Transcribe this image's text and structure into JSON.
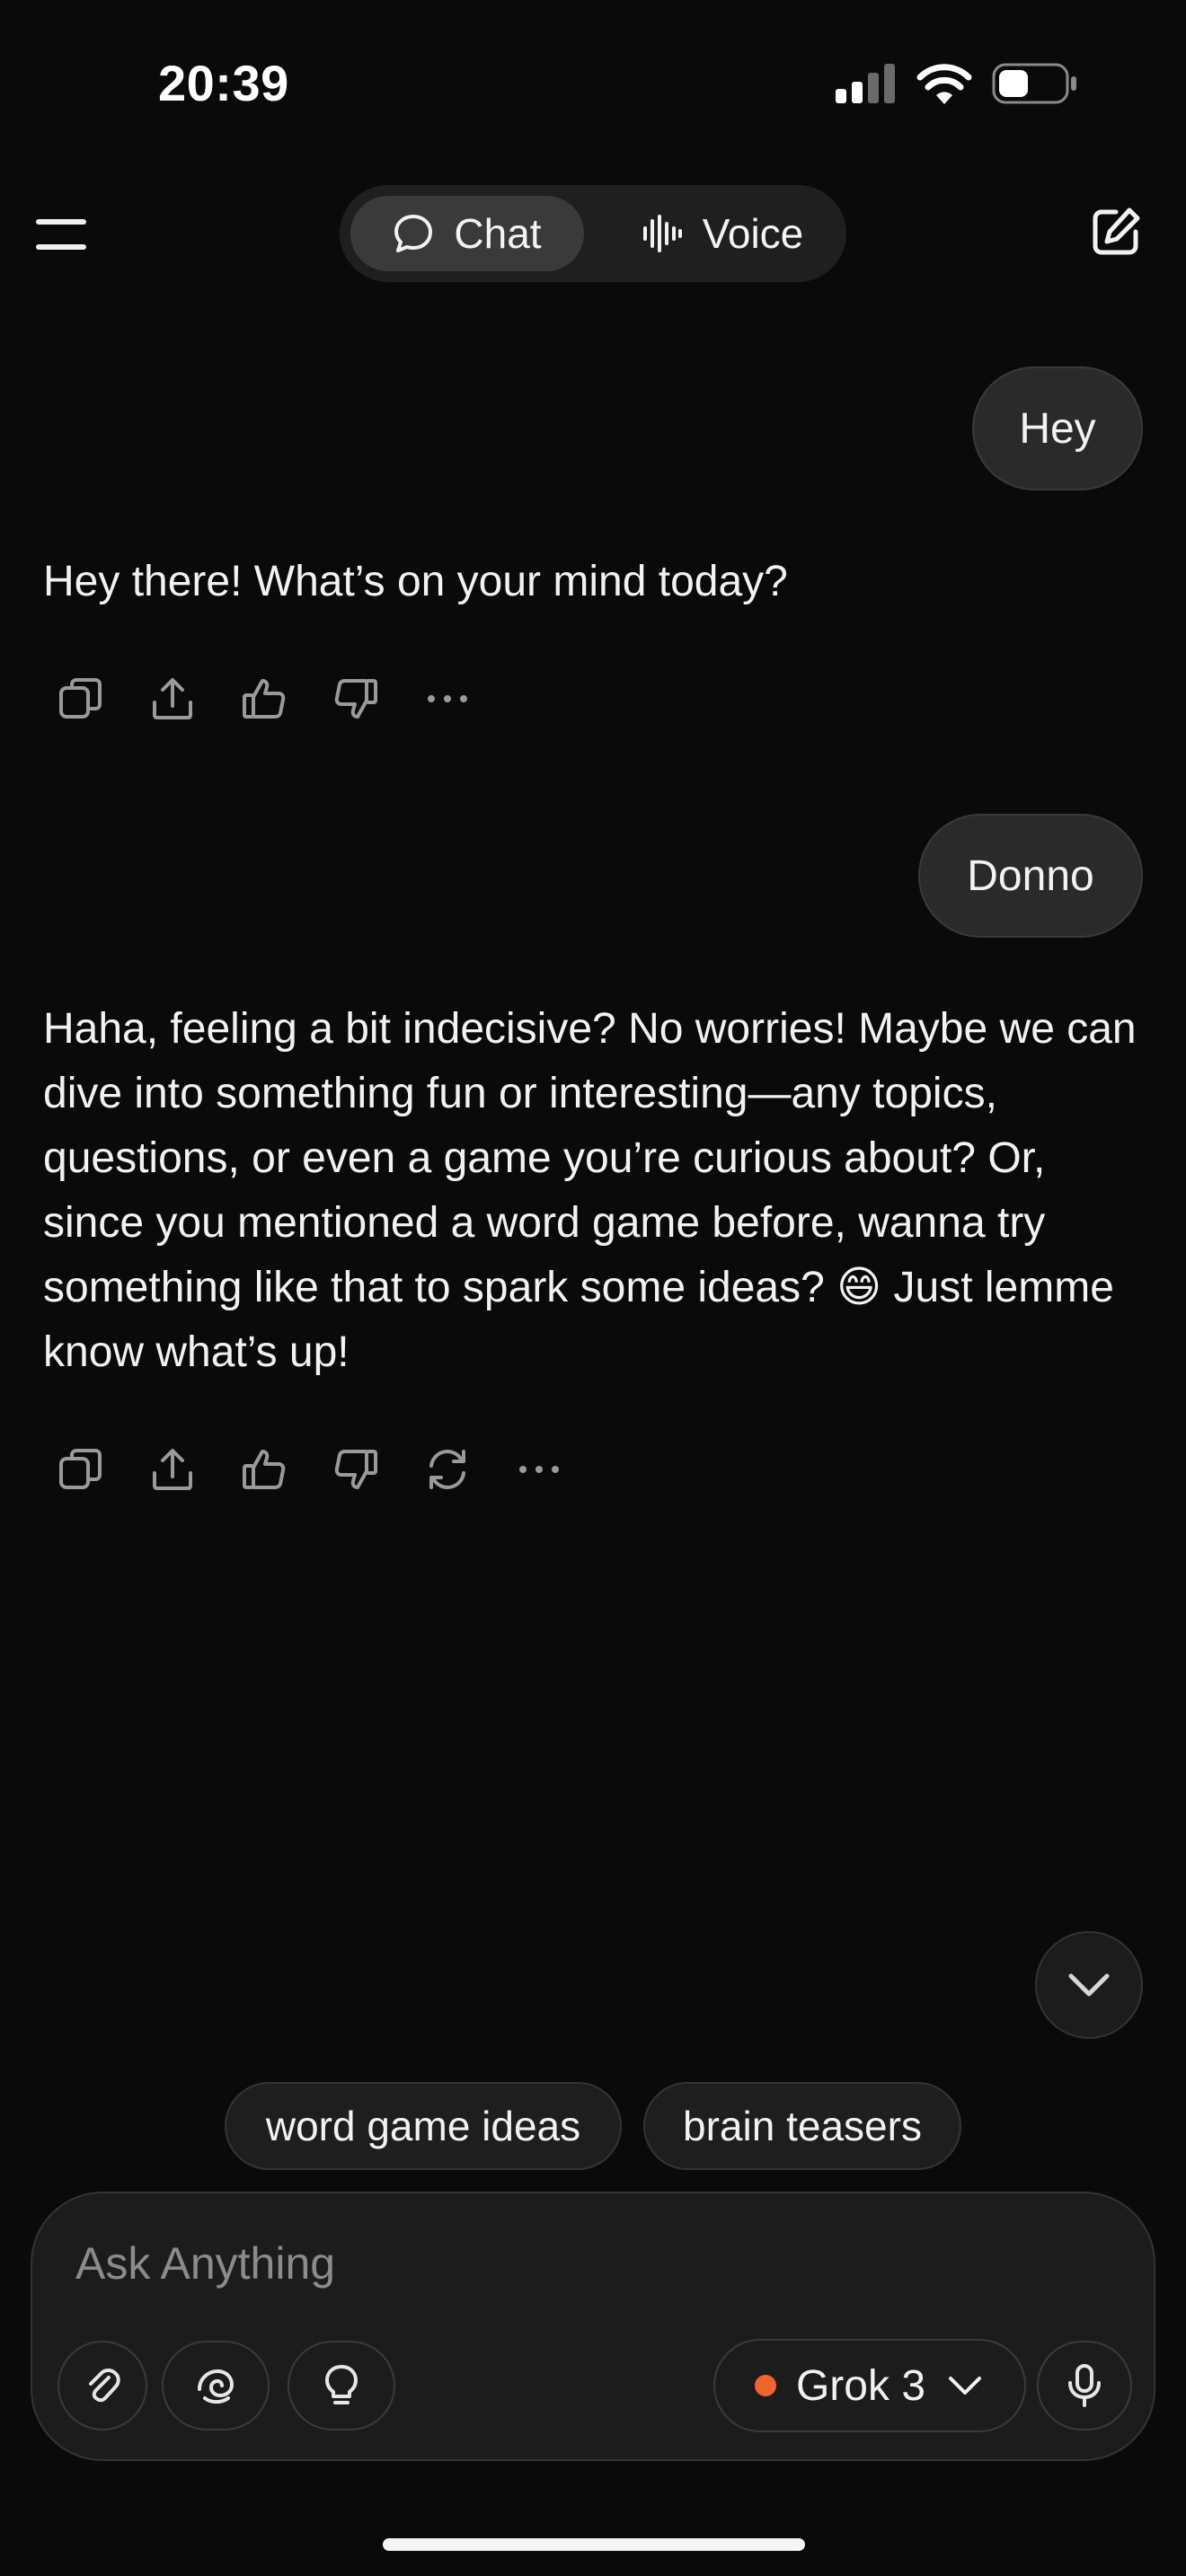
{
  "status_bar": {
    "time": "20:39",
    "icons": [
      "cellular-signal-icon",
      "wifi-icon",
      "battery-icon"
    ]
  },
  "header": {
    "menu_icon": "hamburger-menu-icon",
    "tabs": [
      {
        "label": "Chat",
        "icon": "chat-bubble-icon",
        "selected": true
      },
      {
        "label": "Voice",
        "icon": "waveform-icon",
        "selected": false
      }
    ],
    "compose_icon": "new-chat-icon"
  },
  "conversation": {
    "messages": [
      {
        "role": "user",
        "text": "Hey"
      },
      {
        "role": "assistant",
        "text": "Hey there! What’s on your mind today?"
      },
      {
        "role": "user",
        "text": "Donno"
      },
      {
        "role": "assistant",
        "text": "Haha, feeling a bit indecisive? No worries! Maybe we can dive into something fun or interesting—any topics, questions, or even a game you’re curious about? Or, since you mentioned a word game before, wanna try something like that to spark some ideas? 😄 Just lemme know what’s up!"
      }
    ],
    "message_actions_1": [
      "copy-icon",
      "share-icon",
      "thumbs-up-icon",
      "thumbs-down-icon",
      "more-icon"
    ],
    "message_actions_2": [
      "copy-icon",
      "share-icon",
      "thumbs-up-icon",
      "thumbs-down-icon",
      "regenerate-icon",
      "more-icon"
    ]
  },
  "suggestions": [
    "word game ideas",
    "brain teasers"
  ],
  "composer": {
    "placeholder": "Ask Anything",
    "model": "Grok 3",
    "model_status_color": "#f0642d",
    "tool_icons": [
      "paperclip-icon",
      "think-swirl-icon",
      "lightbulb-icon"
    ],
    "mic_icon": "microphone-icon"
  },
  "colors": {
    "background": "#0a0a0a",
    "bubble": "#2a2a2a",
    "text": "#f2f2f2",
    "muted_icon": "#9a9a9a"
  }
}
